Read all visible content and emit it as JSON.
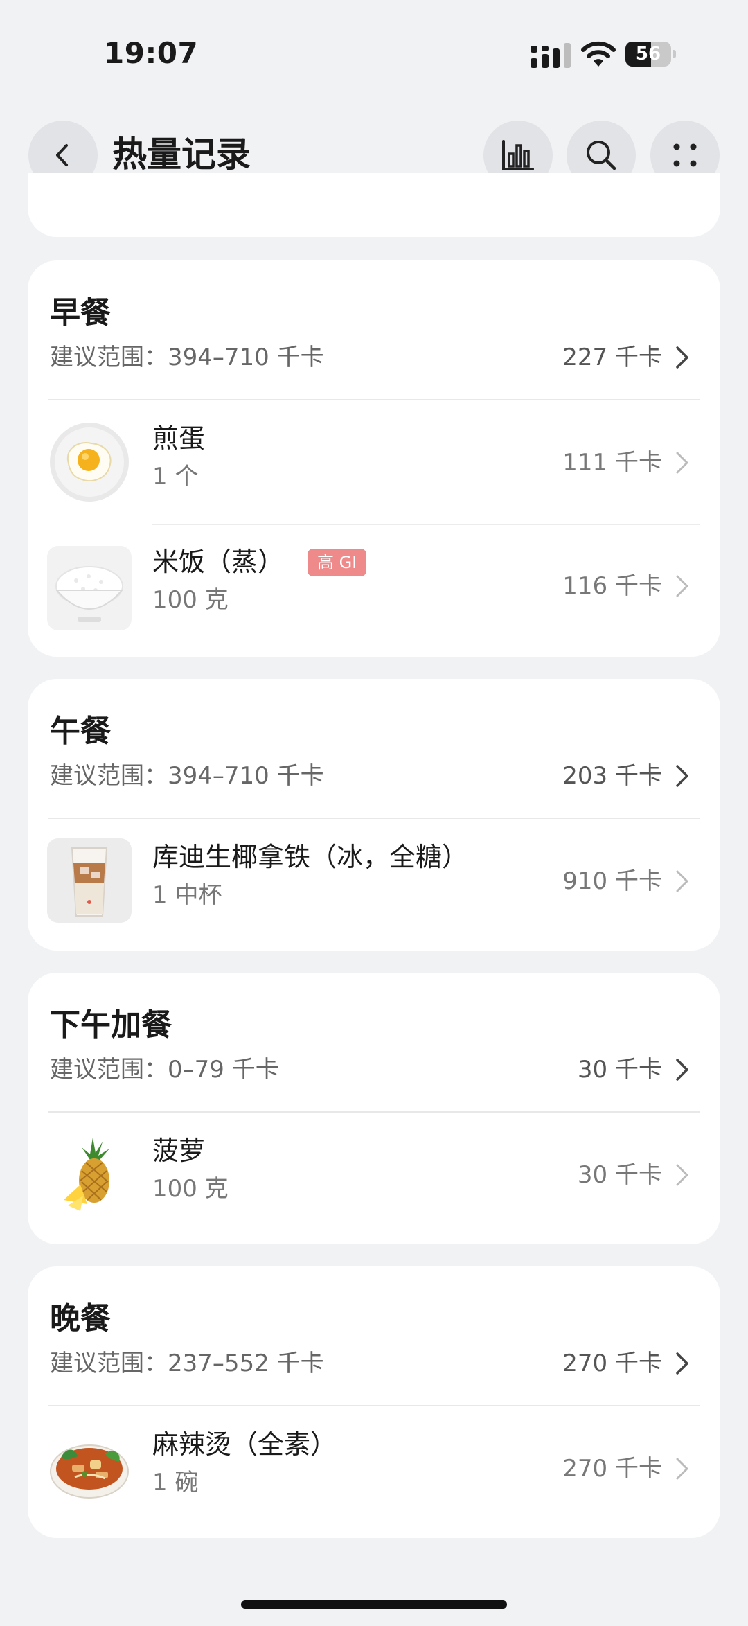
{
  "status_bar": {
    "time": "19:07",
    "battery_level": "56",
    "battery_fraction": 0.56,
    "icons": [
      "signal-icon",
      "wifi-icon",
      "battery-icon"
    ]
  },
  "header": {
    "title": "热量记录",
    "icons": [
      "chevron-left-icon",
      "bar-chart-icon",
      "search-icon",
      "more-dots-icon"
    ]
  },
  "meals": [
    {
      "title": "早餐",
      "range": "建议范围：394–710 千卡",
      "total": "227 千卡",
      "items": [
        {
          "name": "煎蛋",
          "qty": "1 个",
          "kcal": "111 千卡",
          "icon": "fried-egg-image"
        },
        {
          "name": "米饭（蒸）",
          "qty": "100 克",
          "kcal": "116 千卡",
          "icon": "rice-bowl-image",
          "badge": "高 GI"
        }
      ]
    },
    {
      "title": "午餐",
      "range": "建议范围：394–710 千卡",
      "total": "203 千卡",
      "items": [
        {
          "name": "库迪生椰拿铁（冰，全糖）",
          "qty": "1 中杯",
          "kcal": "910 千卡",
          "icon": "iced-latte-image"
        }
      ]
    },
    {
      "title": "下午加餐",
      "range": "建议范围：0–79 千卡",
      "total": "30 千卡",
      "items": [
        {
          "name": "菠萝",
          "qty": "100 克",
          "kcal": "30 千卡",
          "icon": "pineapple-image"
        }
      ]
    },
    {
      "title": "晚餐",
      "range": "建议范围：237–552 千卡",
      "total": "270 千卡",
      "items": [
        {
          "name": "麻辣烫（全素）",
          "qty": "1 碗",
          "kcal": "270 千卡",
          "icon": "malatang-bowl-image"
        }
      ]
    }
  ],
  "colors": {
    "background": "#f1f2f4",
    "card": "#ffffff",
    "gi_badge": "#ee8a8a",
    "button_bg": "#e2e3e6"
  }
}
